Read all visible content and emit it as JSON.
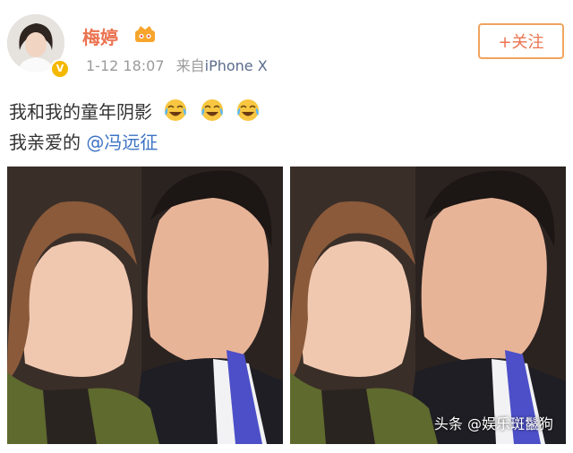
{
  "user": {
    "name": "梅婷",
    "time": "1-12 18:07",
    "source_prefix": "来自",
    "device": "iPhone X",
    "verified_mark": "V"
  },
  "actions": {
    "follow_label": "+关注"
  },
  "post": {
    "line1": "我和我的童年阴影",
    "line2_prefix": "我亲爱的 ",
    "mention": "@冯远征"
  },
  "watermark": "头条 @娱乐斑鬣狗",
  "colors": {
    "username": "#eb7350",
    "mention": "#3e73c4",
    "follow_border": "#f0a45f",
    "meta": "#9a9a9a"
  },
  "icons": [
    "avatar",
    "verified-badge",
    "vip-crown-icon",
    "laugh-cry-emoji-icon"
  ]
}
